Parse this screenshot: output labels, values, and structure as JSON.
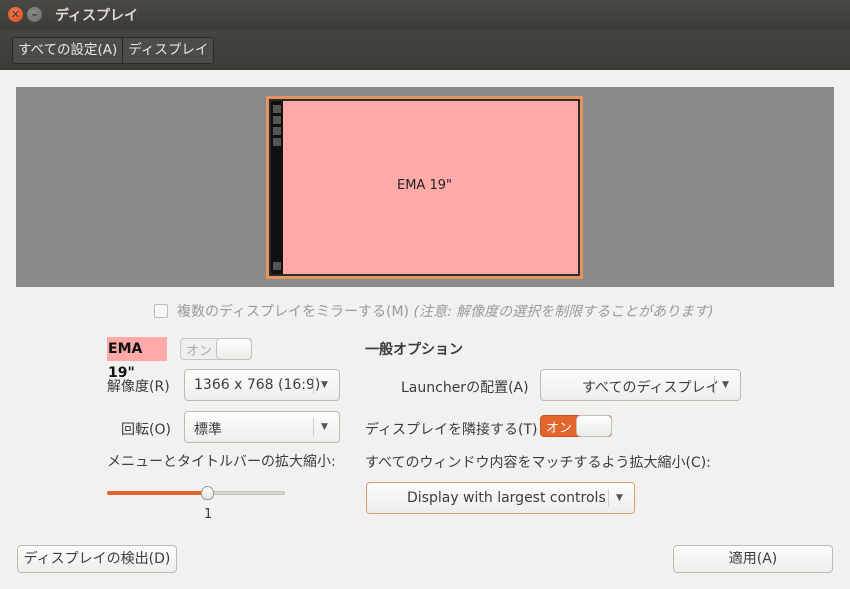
{
  "window": {
    "title": "ディスプレイ",
    "close_glyph": "✕",
    "minimize_glyph": "–"
  },
  "breadcrumb": {
    "items": [
      {
        "label": "すべての設定(A)"
      },
      {
        "label": "ディスプレイ"
      }
    ]
  },
  "preview": {
    "monitor_label": "EMA 19\"",
    "accent_color": "#ffa9a9",
    "frame_color": "#e4945e"
  },
  "mirror": {
    "checked": false,
    "label": "複数のディスプレイをミラーする(M)",
    "note": "(注意: 解像度の選択を制限することがあります)"
  },
  "display": {
    "name": "EMA 19\"",
    "power_toggle": {
      "label": "オン",
      "state": "on (disabled)"
    }
  },
  "resolution": {
    "label": "解像度(R)",
    "value": "1366 x 768 (16:9)"
  },
  "rotation": {
    "label": "回転(O)",
    "value": "標準"
  },
  "scale_menus": {
    "label": "メニューとタイトルバーの拡大縮小:",
    "value": "1",
    "level_fraction": 0.56
  },
  "general": {
    "heading": "一般オプション",
    "launcher_label": "Launcherの配置(A)",
    "launcher_value": "すべてのディスプレイ",
    "sticky_label": "ディスプレイを隣接する(T)",
    "sticky_toggle": {
      "label": "オン",
      "state": "on"
    },
    "scale_windows_label": "すべてのウィンドウ内容をマッチするよう拡大縮小(C):",
    "scale_windows_value": "Display with largest controls"
  },
  "buttons": {
    "detect": "ディスプレイの検出(D)",
    "apply": "適用(A)"
  },
  "colors": {
    "accent": "#e1652c",
    "titlebar": "#3c3b37"
  }
}
